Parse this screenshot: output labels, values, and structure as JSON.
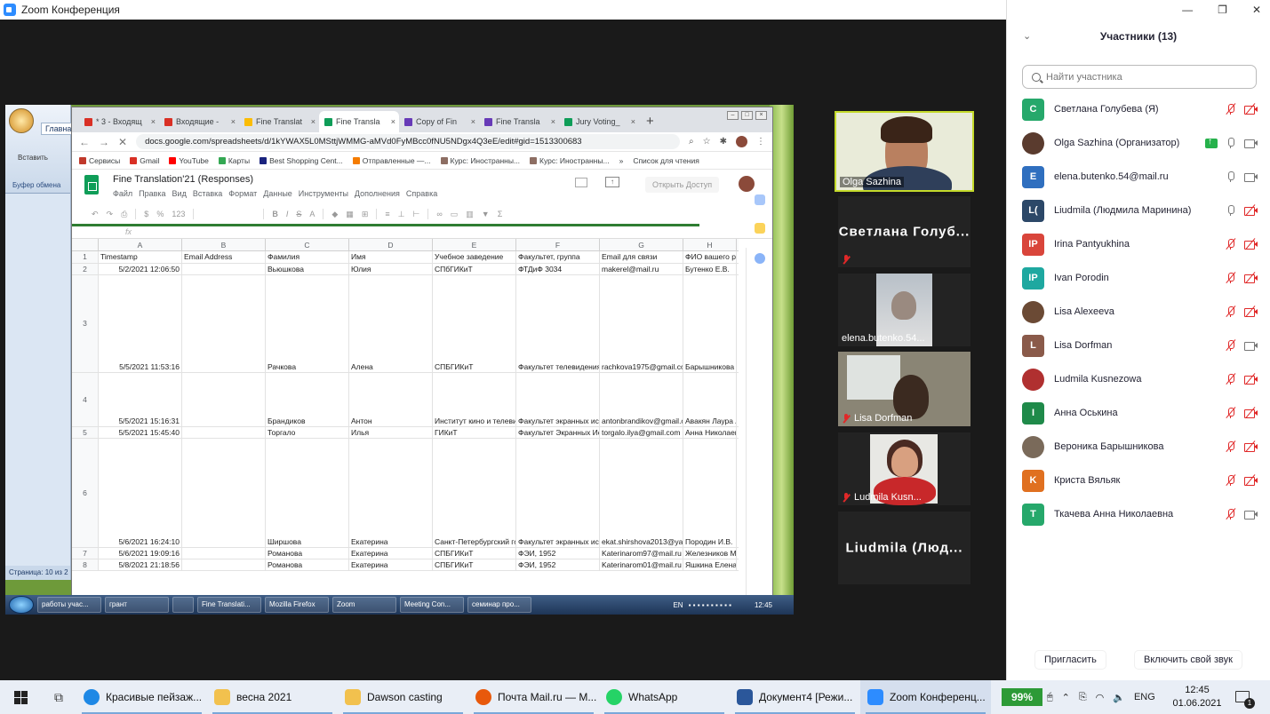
{
  "window": {
    "title": "Zoom Конференция"
  },
  "shared_screen": {
    "word": {
      "tab_main": "Главна",
      "paste": "Вставить",
      "clipboard": "Буфер обмена",
      "status": "Страница: 10 из 2"
    },
    "chrome": {
      "tabs": [
        {
          "label": "* 3 - Входящ",
          "color": "#d93025",
          "active": false
        },
        {
          "label": "Входящие -",
          "color": "#d93025",
          "active": false
        },
        {
          "label": "Fine Translat",
          "color": "#fbbc04",
          "active": false
        },
        {
          "label": "Fine Transla",
          "color": "#0f9d58",
          "active": true
        },
        {
          "label": "Copy of Fin",
          "color": "#673ab7",
          "active": false
        },
        {
          "label": "Fine Transla",
          "color": "#673ab7",
          "active": false
        },
        {
          "label": "Jury Voting_",
          "color": "#0f9d58",
          "active": false
        }
      ],
      "url": "docs.google.com/spreadsheets/d/1kYWAX5L0MSttjWMMG-aMVd0FyMBcc0fNU5NDgx4Q3eE/edit#gid=1513300683",
      "bookmarks": [
        {
          "label": "Сервисы",
          "color": "#c0392b"
        },
        {
          "label": "Gmail",
          "color": "#d93025"
        },
        {
          "label": "YouTube",
          "color": "#ff0000"
        },
        {
          "label": "Карты",
          "color": "#34a853"
        },
        {
          "label": "Best Shopping Cent...",
          "color": "#1a237e"
        },
        {
          "label": "Отправленные —...",
          "color": "#f57c00"
        },
        {
          "label": "Курс: Иностранны...",
          "color": "#8d6e63"
        },
        {
          "label": "Курс: Иностранны...",
          "color": "#8d6e63"
        }
      ],
      "bookmarks_more": "»",
      "reading_list": "Список для чтения",
      "sheet": {
        "title": "Fine Translation'21 (Responses)",
        "menu": [
          "Файл",
          "Правка",
          "Вид",
          "Вставка",
          "Формат",
          "Данные",
          "Инструменты",
          "Дополнения",
          "Справка"
        ],
        "share_button": "Открыть Доступ",
        "toolbar_zoom": "123",
        "fx": "fx",
        "col_letters": [
          "A",
          "B",
          "C",
          "D",
          "E",
          "F",
          "G",
          "H"
        ],
        "header": [
          "Timestamp",
          "Email Address",
          "Фамилия",
          "Имя",
          "Учебное заведение",
          "Факультет, группа",
          "Email для связи",
          "ФИО вашего ру"
        ],
        "rows": [
          {
            "n": "2",
            "cells": [
              "5/2/2021 12:06:50",
              "",
              "Вьюшкова",
              "Юлия",
              "СПбГИКиТ",
              "ФТДиФ 3034",
              "makerel@mail.ru",
              "Бутенко Е.В."
            ]
          },
          {
            "n": "3",
            "cells": [
              "5/5/2021 11:53:16",
              "",
              "Рачкова",
              "Алена",
              "СПБГИКиТ",
              "Факультет телевидения",
              "rachkova1975@gmail.co",
              "Барышникова В"
            ]
          },
          {
            "n": "4",
            "cells": [
              "5/5/2021 15:16:31",
              "",
              "Брандиков",
              "Антон",
              "Институт кино и телевид",
              "Факультет экранных иск",
              "antonbrandikov@gmail.c",
              "Авакян Лаура А"
            ]
          },
          {
            "n": "5",
            "cells": [
              "5/5/2021 15:45:40",
              "",
              "Торгало",
              "Илья",
              "ГИКиТ",
              "Факультет Экранных Ис",
              "torgalo.ilya@gmail.com",
              "Анна Николаев"
            ]
          },
          {
            "n": "6",
            "cells": [
              "5/6/2021 16:24:10",
              "",
              "Ширшова",
              "Екатерина",
              "Санкт-Петербургский го",
              "Факультет экранных иск",
              "ekat.shirshova2013@yar",
              "Породин И.В."
            ]
          },
          {
            "n": "7",
            "cells": [
              "5/6/2021 19:09:16",
              "",
              "Романова",
              "Екатерина",
              "СПБГИКиТ",
              "ФЭИ, 1952",
              "Katerinarom97@mail.ru",
              "Железников М"
            ]
          },
          {
            "n": "8",
            "cells": [
              "5/8/2021 21:18:56",
              "",
              "Романова",
              "Екатерина",
              "СПБГИКиТ",
              "ФЭИ, 1952",
              "Katerinarom01@mail.ru",
              "Яшкина Елена"
            ]
          }
        ]
      }
    },
    "win7_taskbar": {
      "items": [
        "работы учас...",
        "грант",
        "",
        "Fine Translati...",
        "Mozilla Firefox",
        "Zoom",
        "Meeting Con...",
        "семинар про..."
      ],
      "lang": "EN",
      "time": "12:45"
    }
  },
  "video_tiles": [
    {
      "name": "Olga Sazhina",
      "type": "video",
      "muted": false
    },
    {
      "name": "Светлана  Голуб...",
      "type": "name",
      "muted": true
    },
    {
      "name": "elena.butenko.54...",
      "type": "video",
      "muted": false
    },
    {
      "name": "Lisa Dorfman",
      "type": "video",
      "muted": true
    },
    {
      "name": "Ludmila Kusn...",
      "type": "video",
      "muted": true
    },
    {
      "name": "Liudmila  (Люд...",
      "type": "name",
      "muted": false
    }
  ],
  "participants_panel": {
    "title": "Участники (13)",
    "search_placeholder": "Найти участника",
    "participants": [
      {
        "initials": "С",
        "name": "Светлана Голубева (Я)",
        "color": "#26a86b",
        "photo": false,
        "mic": "muted",
        "cam": "muted",
        "share": false
      },
      {
        "initials": "",
        "name": "Olga Sazhina (Организатор)",
        "color": "#5a3b2e",
        "photo": true,
        "mic": "on",
        "cam": "on",
        "share": true
      },
      {
        "initials": "E",
        "name": "elena.butenko.54@mail.ru",
        "color": "#2f6fbf",
        "photo": false,
        "mic": "on",
        "cam": "on",
        "share": false
      },
      {
        "initials": "L(",
        "name": "Liudmila (Людмила Маринина)",
        "color": "#2c4868",
        "photo": false,
        "mic": "on",
        "cam": "muted",
        "share": false
      },
      {
        "initials": "IP",
        "name": "Irina Pantyukhina",
        "color": "#d9453b",
        "photo": false,
        "mic": "muted",
        "cam": "muted",
        "share": false
      },
      {
        "initials": "IP",
        "name": "Ivan Porodin",
        "color": "#1ea8a0",
        "photo": false,
        "mic": "muted",
        "cam": "muted",
        "share": false
      },
      {
        "initials": "",
        "name": "Lisa Alexeeva",
        "color": "#6b4a35",
        "photo": true,
        "mic": "muted",
        "cam": "muted",
        "share": false
      },
      {
        "initials": "L",
        "name": "Lisa Dorfman",
        "color": "#8a5a4a",
        "photo": false,
        "mic": "muted",
        "cam": "on",
        "share": false
      },
      {
        "initials": "",
        "name": "Ludmila Kusnezowa",
        "color": "#b03030",
        "photo": true,
        "mic": "muted",
        "cam": "muted",
        "share": false
      },
      {
        "initials": "I",
        "name": "Анна Оськина",
        "color": "#1f8a4a",
        "photo": false,
        "mic": "muted",
        "cam": "muted",
        "share": false
      },
      {
        "initials": "",
        "name": "Вероника Барышникова",
        "color": "#7a6a5a",
        "photo": true,
        "mic": "muted",
        "cam": "muted",
        "share": false
      },
      {
        "initials": "K",
        "name": "Криста Вяльяк",
        "color": "#e07020",
        "photo": false,
        "mic": "muted",
        "cam": "muted",
        "share": false
      },
      {
        "initials": "T",
        "name": "Ткачева Анна Николаевна",
        "color": "#26a86b",
        "photo": false,
        "mic": "muted",
        "cam": "on",
        "share": false
      }
    ],
    "invite_button": "Пригласить",
    "unmute_button": "Включить свой звук"
  },
  "taskbar": {
    "items": [
      {
        "label": "Красивые пейзаж...",
        "color": "#1e88e5",
        "active": false
      },
      {
        "label": "весна 2021",
        "color": "#f2c14e",
        "active": false
      },
      {
        "label": "Dawson casting",
        "color": "#f2c14e",
        "active": false
      },
      {
        "label": "Почта Mail.ru — M...",
        "color": "#e8590c",
        "active": false
      },
      {
        "label": "WhatsApp",
        "color": "#25d366",
        "active": false
      },
      {
        "label": "Документ4 [Режи...",
        "color": "#2b579a",
        "active": false
      },
      {
        "label": "Zoom Конференц...",
        "color": "#2d8cff",
        "active": true
      }
    ],
    "battery": "99%",
    "lang": "ENG",
    "time": "12:45",
    "date": "01.06.2021",
    "notifications": "1"
  }
}
